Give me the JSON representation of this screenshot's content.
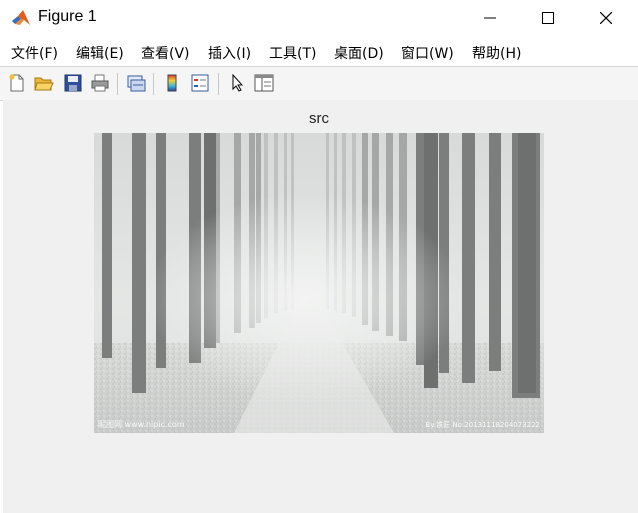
{
  "window": {
    "title": "Figure 1"
  },
  "menu": [
    "文件(F)",
    "编辑(E)",
    "查看(V)",
    "插入(I)",
    "工具(T)",
    "桌面(D)",
    "窗口(W)",
    "帮助(H)"
  ],
  "toolbar": {
    "icons": [
      "new-figure-icon",
      "open-file-icon",
      "save-icon",
      "print-icon",
      "link-plot-icon",
      "colorbar-icon",
      "legend-icon",
      "edit-plot-icon",
      "property-inspector-icon"
    ]
  },
  "axes": {
    "title": "src"
  },
  "image": {
    "subject": "misty forest path with rows of tall bare trees",
    "watermark_left": "昵图网 www.nipic.com",
    "watermark_right": "By:铁匠  No:20131118204073222"
  },
  "colors": {
    "titlebar": "#ffffff",
    "figure_bg": "#f0f0f0",
    "toolbar_bg": "#f5f5f5"
  }
}
